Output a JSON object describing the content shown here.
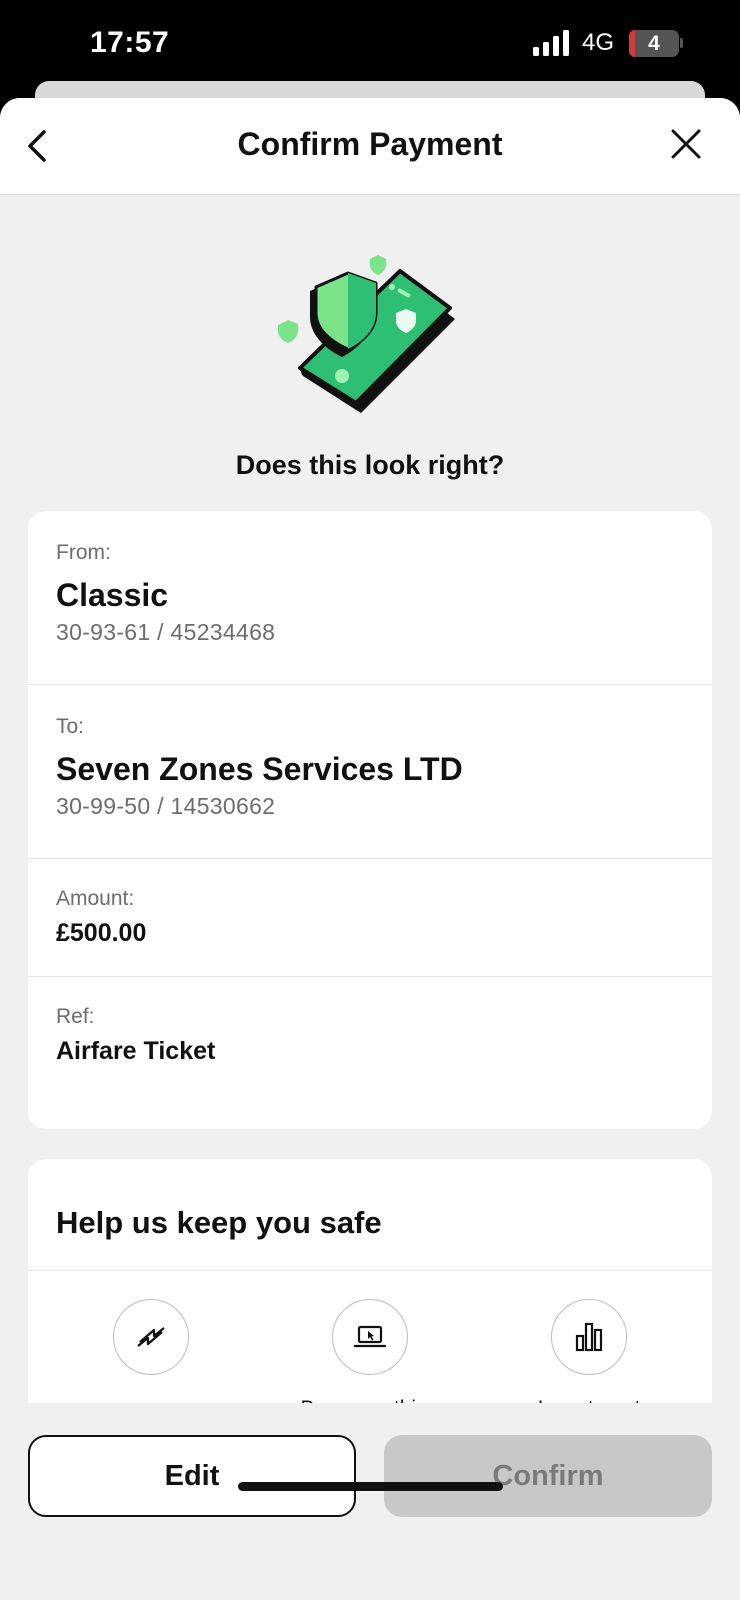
{
  "status_bar": {
    "time": "17:57",
    "network": "4G",
    "battery": "4"
  },
  "nav": {
    "title": "Confirm Payment",
    "back_icon": "chevron-left-icon",
    "close_icon": "close-icon"
  },
  "illustration": "phone-shield-illustration",
  "question": "Does this look right?",
  "details": {
    "from": {
      "label": "From:",
      "account_name": "Classic",
      "account_number": "30-93-61 / 45234468"
    },
    "to": {
      "label": "To:",
      "payee_name": "Seven Zones Services LTD",
      "account_number": "30-99-50 / 14530662"
    },
    "amount": {
      "label": "Amount:",
      "value": "£500.00"
    },
    "reference": {
      "label": "Ref:",
      "value": "Airfare Ticket"
    }
  },
  "safety": {
    "title": "Help us keep you safe",
    "options": [
      {
        "icon": "transfer-arrows-icon",
        "label": ""
      },
      {
        "icon": "laptop-cursor-icon",
        "label": "Buy something"
      },
      {
        "icon": "bar-chart-icon",
        "label": "Investment"
      }
    ]
  },
  "actions": {
    "edit_label": "Edit",
    "confirm_label": "Confirm"
  },
  "colors": {
    "brand_green": "#2fbf74",
    "light_green": "#7be38a",
    "disabled_button": "#c8c8c8",
    "background": "#f0f0f0"
  }
}
